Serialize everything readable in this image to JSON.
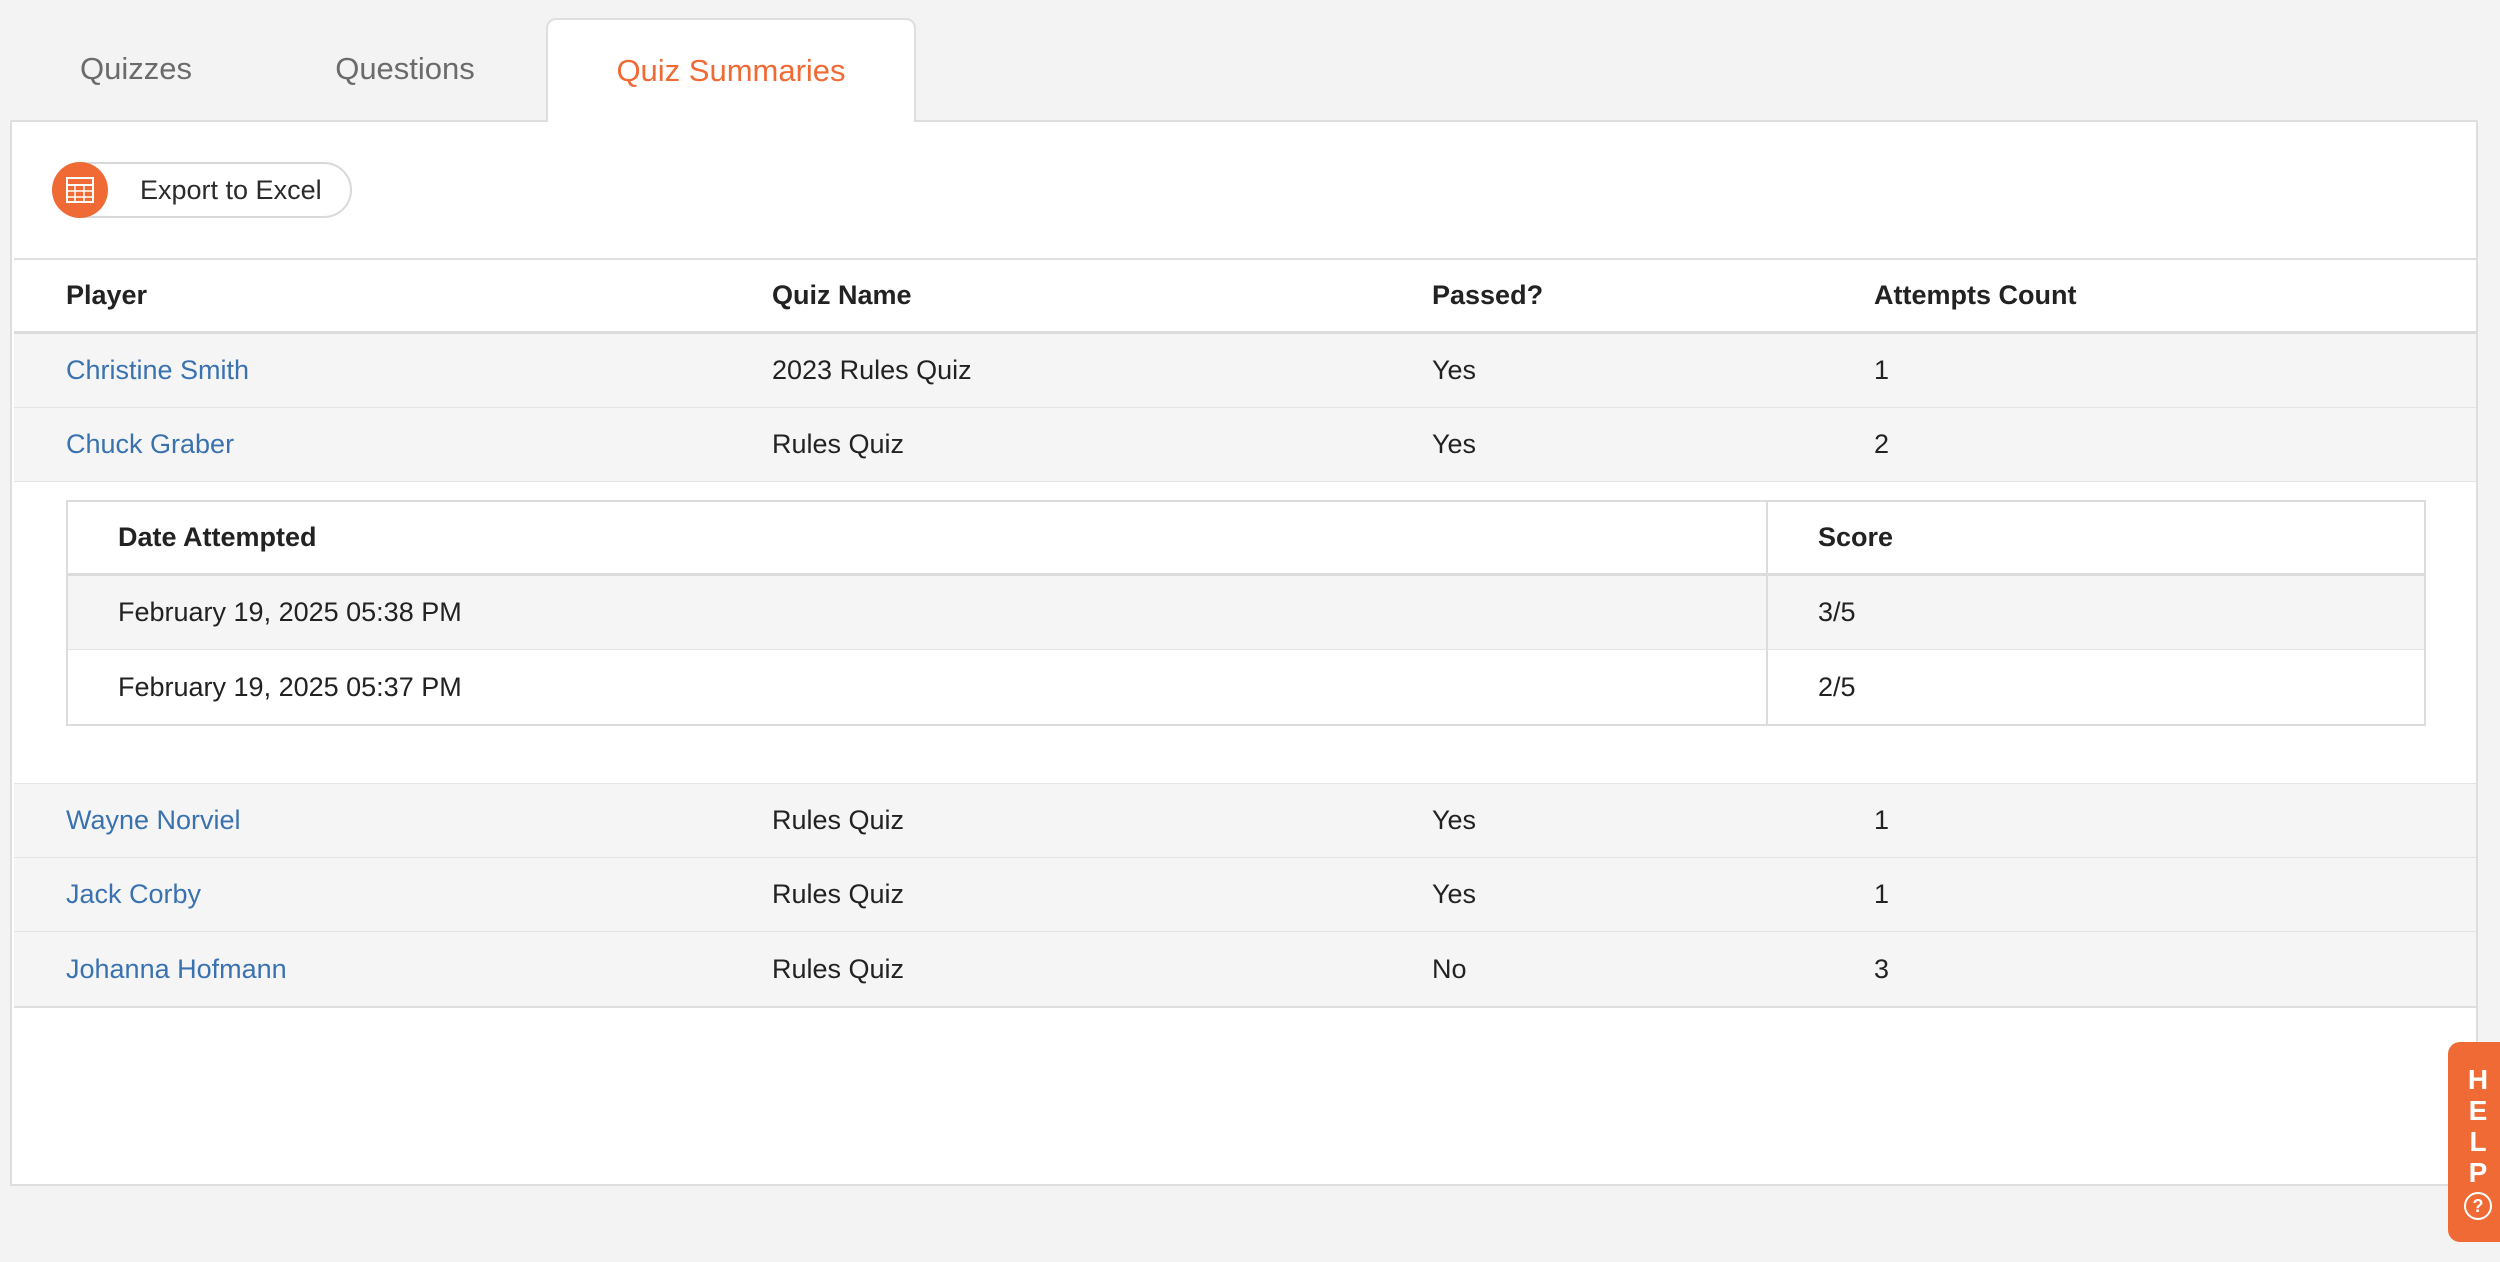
{
  "tabs": [
    {
      "label": "Quizzes"
    },
    {
      "label": "Questions"
    },
    {
      "label": "Quiz Summaries"
    }
  ],
  "toolbar": {
    "export_label": "Export to Excel",
    "export_icon": "spreadsheet-icon"
  },
  "table": {
    "headers": [
      "Player",
      "Quiz Name",
      "Passed?",
      "Attempts Count"
    ],
    "rows": [
      {
        "player": "Christine Smith",
        "quiz": "2023 Rules Quiz",
        "passed": "Yes",
        "attempts": "1"
      },
      {
        "player": "Chuck Graber",
        "quiz": "Rules Quiz",
        "passed": "Yes",
        "attempts": "2"
      },
      {
        "player": "Wayne Norviel",
        "quiz": "Rules Quiz",
        "passed": "Yes",
        "attempts": "1"
      },
      {
        "player": "Jack Corby",
        "quiz": "Rules Quiz",
        "passed": "Yes",
        "attempts": "1"
      },
      {
        "player": "Johanna Hofmann",
        "quiz": "Rules Quiz",
        "passed": "No",
        "attempts": "3"
      }
    ]
  },
  "attempts": {
    "headers": [
      "Date Attempted",
      "Score"
    ],
    "rows": [
      {
        "date": "February 19, 2025 05:38 PM",
        "score": "3/5"
      },
      {
        "date": "February 19, 2025 05:37 PM",
        "score": "2/5"
      }
    ]
  },
  "help": {
    "letters": [
      "H",
      "E",
      "L",
      "P"
    ],
    "icon": "question-circle-icon"
  },
  "colors": {
    "accent": "#f06a35",
    "link": "#3a72b0"
  }
}
